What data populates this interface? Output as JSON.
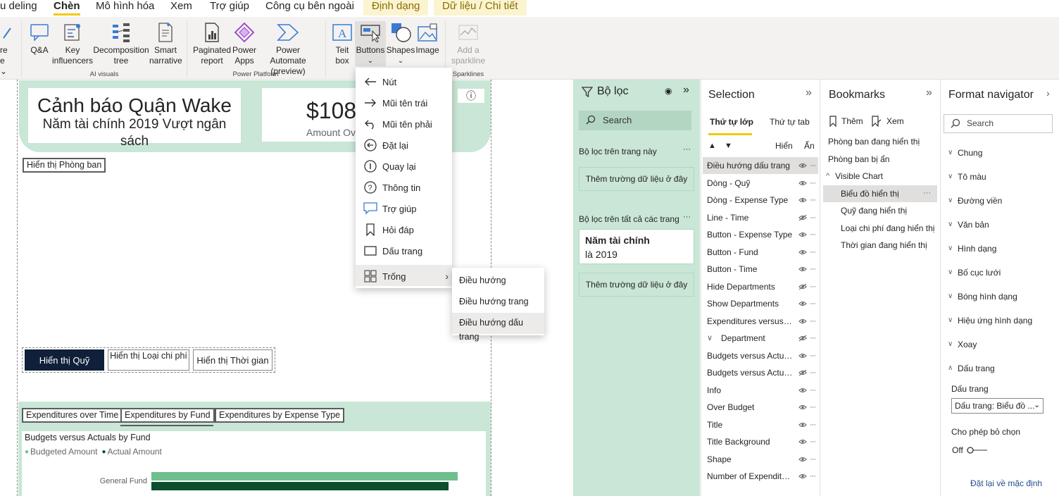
{
  "tabs": [
    {
      "label": "u deling"
    },
    {
      "label": "Chèn"
    },
    {
      "label": "Mô hình hóa"
    },
    {
      "label": "Xem"
    },
    {
      "label": "Trợ giúp"
    },
    {
      "label": "Công cụ bên ngoài"
    },
    {
      "label": "Định dạng"
    },
    {
      "label": "Dữ liệu / Chi tiết"
    }
  ],
  "ribbon": {
    "left_partial_line1": "re",
    "left_partial_line2": "e ⌄",
    "qa": "Q&A",
    "key_influencers": "Key influencers",
    "decomposition_tree": "Decomposition tree",
    "smart_narrative": "Smart narrative",
    "group_ai": "AI visuals",
    "paginated_report": "Paginated report",
    "power_apps": "Power Apps",
    "power_automate": "Power Automate (preview)",
    "group_power_platform": "Power Platform",
    "text_box": "Teit box",
    "buttons": "Buttons",
    "shapes": "Shapes",
    "image": "Image",
    "add_sparkline": "Add a sparkline",
    "group_sparklines": "Sparklines"
  },
  "canvas": {
    "title_line1": "Cảnh báo Quận Wake",
    "title_line2": "Năm tài chính 2019 Vượt ngân sách",
    "kpi_value": "$108",
    "kpi_label": "Amount Ov",
    "show_department": "Hiển thị Phòng ban",
    "show_fund": "Hiển thị Quỹ",
    "show_expense_type": "Hiển thị Loại chi phí",
    "show_time": "Hiển thị Thời gian",
    "exp_over_time": "Expenditures over Time",
    "exp_by_fund": "Expenditures by Fund",
    "exp_by_type": "Expenditures by Expense Type",
    "chart_title": "Budgets versus Actuals by Fund",
    "legend_budgeted": "Budgeted Amount",
    "legend_actual": "Actual Amount",
    "chart_category": "General Fund"
  },
  "chart_data": {
    "type": "bar",
    "title": "Budgets versus Actuals by Fund",
    "categories": [
      "General Fund"
    ],
    "series": [
      {
        "name": "Budgeted Amount",
        "values": [
          1.0
        ]
      },
      {
        "name": "Actual Amount",
        "values": [
          0.97
        ]
      }
    ],
    "colors": {
      "Budgeted Amount": "#6fbf8e",
      "Actual Amount": "#0e4d2e"
    }
  },
  "buttons_menu": [
    {
      "label": "Nút",
      "icon": "arrow-left-icon"
    },
    {
      "label": "Mũi tên trái",
      "icon": "arrow-right-icon"
    },
    {
      "label": "Mũi tên phải",
      "icon": "undo-arrow-icon"
    },
    {
      "label": "Đặt lại",
      "icon": "reset-circle-icon"
    },
    {
      "label": "Quay lại",
      "icon": "info-circle-icon"
    },
    {
      "label": "Thông tin",
      "icon": "question-circle-icon"
    },
    {
      "label": "Trợ giúp",
      "icon": "speech-bubble-icon"
    },
    {
      "label": "Hỏi đáp",
      "icon": "bookmark-icon"
    },
    {
      "label": "Dấu trang",
      "icon": "blank-rect-icon"
    },
    {
      "label": "Trống",
      "icon": "grid-icon"
    }
  ],
  "submenu": [
    "Điều hướng",
    "Điều hướng trang",
    "Điều hướng dấu trang"
  ],
  "filter_pane": {
    "title": "Bộ lọc",
    "search_placeholder": "Search",
    "on_page": "Bộ lọc trên trang này",
    "add_field_1": "Thêm trường dữ liệu ở đây",
    "all_pages": "Bộ lọc trên tất cả các trang",
    "card_title": "Năm tài chính",
    "card_value": "là 2019",
    "add_field_2": "Thêm trường dữ liệu ở đây"
  },
  "selection_pane": {
    "title": "Selection",
    "tab_layer_order": "Thứ tự lớp",
    "tab_tab_order": "Thứ tự tab",
    "col_show": "Hiển",
    "col_hide": "Ẩn",
    "rows": [
      "Điều hướng dấu trang",
      "Dòng - Quỹ",
      "Dòng - Expense Type",
      "Line - Time",
      "Button  - Expense Type",
      "Button - Fund",
      "Button - Time",
      "Hide Departments",
      "Show Departments",
      "Expenditures versus B...",
      "Department",
      "Budgets versus Actual...",
      "Budgets versus Actual...",
      "Info",
      "Over Budget",
      "Title",
      "Title Background",
      "Shape",
      "Number of Expenditur..."
    ]
  },
  "bookmarks_pane": {
    "title": "Bookmarks",
    "add": "Thêm",
    "view": "Xem",
    "items": [
      "Phòng ban đang hiển thị",
      "Phòng ban bị ẩn",
      "Visible Chart",
      "Biểu đồ hiển thị",
      "Quỹ đang hiển thị",
      "Loại chi phí đang hiển thị",
      "Thời gian đang hiển thị"
    ]
  },
  "format_pane": {
    "title": "Format navigator",
    "search_placeholder": "Search",
    "sections": [
      "Chung",
      "Tô màu",
      "Đường viền",
      "Văn bản",
      "Hình dạng",
      "Bố cục lưới",
      "Bóng hình dạng",
      "Hiệu ứng hình dạng",
      "Xoay",
      "Dấu trang"
    ],
    "bookmark_label": "Dấu trang",
    "bookmark_value": "Dấu trang: Biểu đồ ...",
    "allow_deselect": "Cho phép bỏ chọn",
    "toggle_state": "Off",
    "reset": "Đặt lại về mặc định"
  }
}
